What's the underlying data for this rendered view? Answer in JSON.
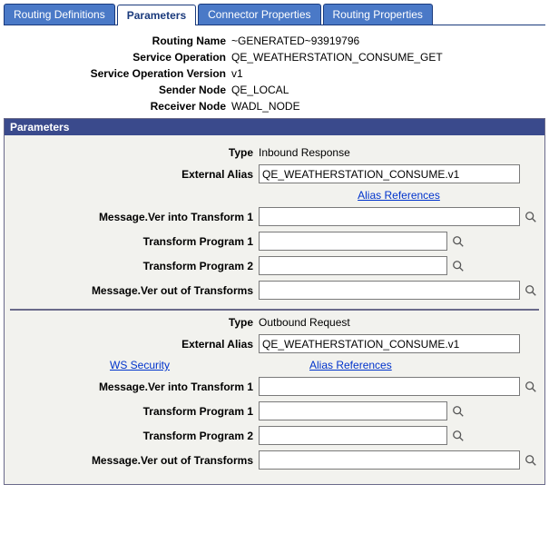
{
  "tabs": {
    "t0": "Routing Definitions",
    "t1": "Parameters",
    "t2": "Connector Properties",
    "t3": "Routing Properties",
    "activeIndex": 1
  },
  "header": {
    "routingName": {
      "label": "Routing Name",
      "value": "~GENERATED~93919796"
    },
    "serviceOperation": {
      "label": "Service Operation",
      "value": "QE_WEATHERSTATION_CONSUME_GET"
    },
    "serviceOperationVersion": {
      "label": "Service Operation Version",
      "value": "v1"
    },
    "senderNode": {
      "label": "Sender Node",
      "value": "QE_LOCAL"
    },
    "receiverNode": {
      "label": "Receiver Node",
      "value": "WADL_NODE"
    }
  },
  "panel": {
    "title": "Parameters",
    "labels": {
      "type": "Type",
      "externalAlias": "External Alias",
      "aliasReferences": "Alias References",
      "wsSecurity": "WS Security",
      "msgVerInto1": "Message.Ver into Transform 1",
      "transformProgram1": "Transform Program 1",
      "transformProgram2": "Transform Program 2",
      "msgVerOut": "Message.Ver out of Transforms"
    },
    "inbound": {
      "typeValue": "Inbound Response",
      "externalAliasValue": "QE_WEATHERSTATION_CONSUME.v1",
      "msgVerInto1Value": "",
      "transformProgram1Value": "",
      "transformProgram2Value": "",
      "msgVerOutValue": ""
    },
    "outbound": {
      "typeValue": "Outbound Request",
      "externalAliasValue": "QE_WEATHERSTATION_CONSUME.v1",
      "msgVerInto1Value": "",
      "transformProgram1Value": "",
      "transformProgram2Value": "",
      "msgVerOutValue": ""
    }
  }
}
